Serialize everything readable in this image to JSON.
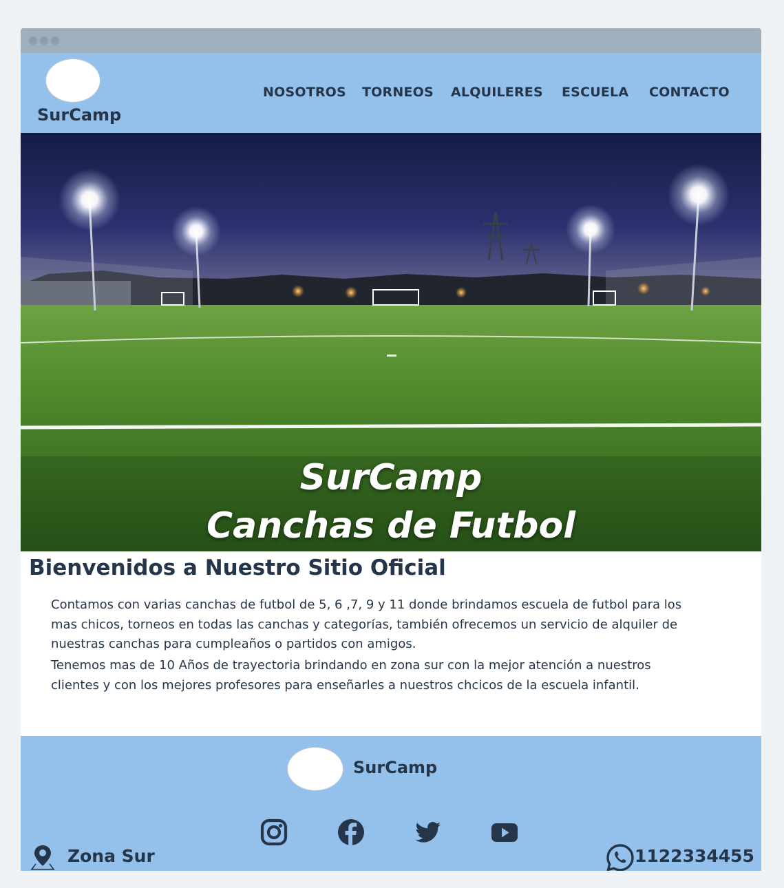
{
  "header": {
    "brand": "SurCamp",
    "nav": [
      "NOSOTROS",
      "TORNEOS",
      "ALQUILERES",
      "ESCUELA",
      "CONTACTO"
    ]
  },
  "hero": {
    "title_line1": "SurCamp",
    "title_line2": "Canchas de Futbol"
  },
  "main": {
    "heading": "Bienvenidos a Nuestro Sitio Oficial",
    "paragraph1": "Contamos con varias canchas de futbol de 5, 6 ,7, 9 y 11 donde brindamos escuela de futbol para los mas chicos, torneos en todas las canchas y categorías, también ofrecemos un servicio de alquiler de nuestras canchas para cumpleaños o partidos con amigos.",
    "paragraph2": "Tenemos mas de 10 Años de trayectoria brindando en zona sur con la mejor atención a nuestros clientes  y con los mejores profesores para enseñarles a nuestros chcicos de la escuela infantil."
  },
  "footer": {
    "brand": "SurCamp",
    "location": "Zona Sur",
    "phone": "1122334455",
    "social_icons": [
      "instagram-icon",
      "facebook-icon",
      "twitter-icon",
      "youtube-icon"
    ]
  },
  "colors": {
    "header_bg": "#94c1eb",
    "footer_bg": "#94c1eb",
    "text": "#25364a",
    "page_bg": "#eff2f5"
  }
}
